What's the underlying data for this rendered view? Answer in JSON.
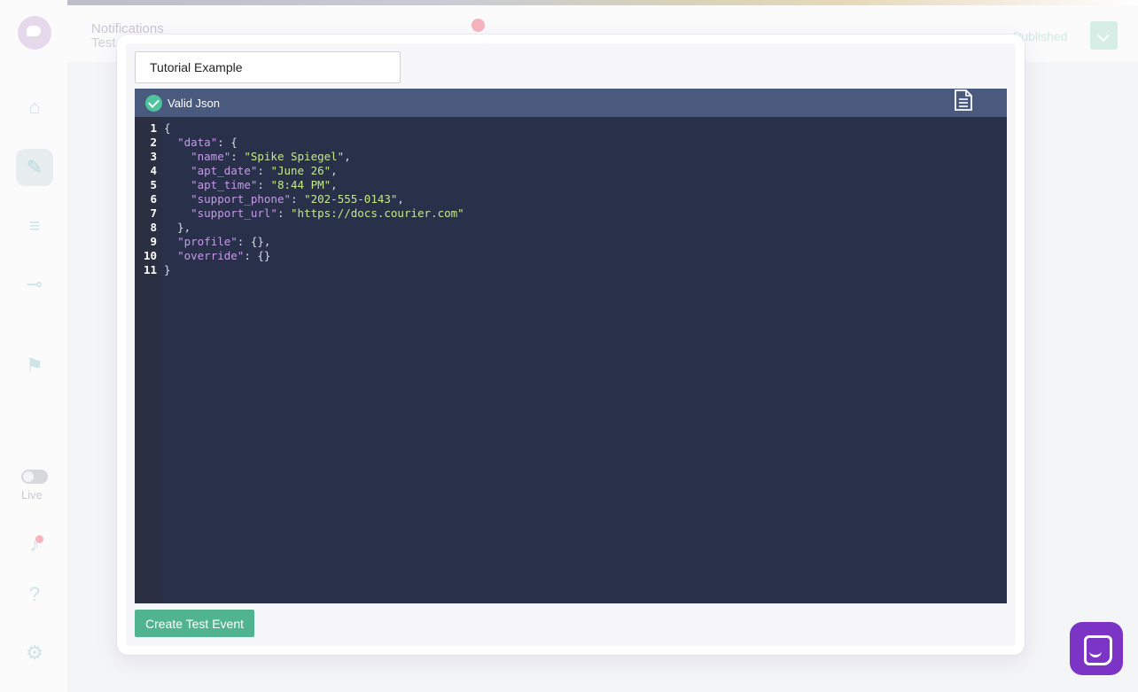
{
  "header": {
    "breadcrumb_top": "Notifications",
    "breadcrumb_bottom": "Test",
    "status": "Published"
  },
  "sidebar": {
    "live_label": "Live"
  },
  "modal": {
    "event_name_value": "Tutorial Example",
    "validation_label": "Valid Json",
    "create_button_label": "Create Test Event"
  },
  "editor": {
    "line_numbers": [
      "1",
      "2",
      "3",
      "4",
      "5",
      "6",
      "7",
      "8",
      "9",
      "10",
      "11"
    ],
    "lines": [
      "{",
      "  \"data\": {",
      "    \"name\": \"Spike Spiegel\",",
      "    \"apt_date\": \"June 26\",",
      "    \"apt_time\": \"8:44 PM\",",
      "    \"support_phone\": \"202-555-0143\",",
      "    \"support_url\": \"https://docs.courier.com\"",
      "  },",
      "  \"profile\": {},",
      "  \"override\": {}",
      "}"
    ]
  },
  "colors": {
    "accent_green": "#4fb48f",
    "editor_bg": "#283149",
    "editor_header": "#4a5a7e",
    "chat_purple": "#7c34c7"
  },
  "icons": [
    "home-icon",
    "palette-icon",
    "database-icon",
    "plug-icon",
    "flag-icon",
    "bell-icon",
    "help-icon",
    "gear-icon",
    "copy-icon",
    "check-circle-icon",
    "chat-icon"
  ]
}
